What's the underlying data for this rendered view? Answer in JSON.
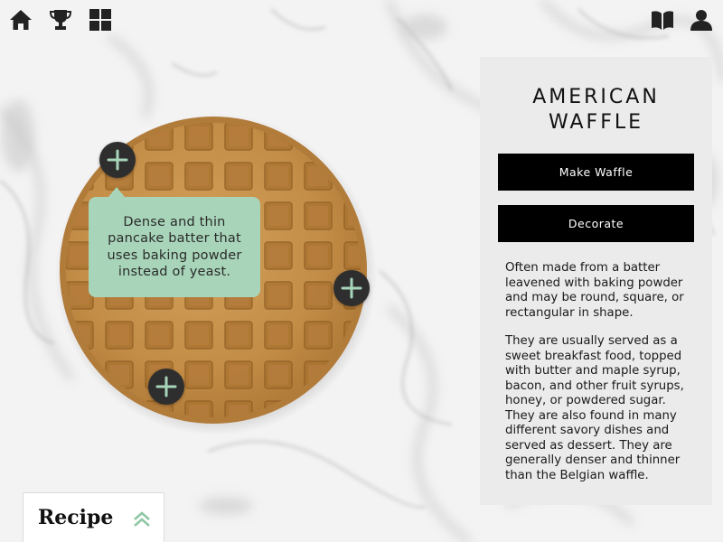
{
  "nav": {
    "left_icons": [
      "home-icon",
      "trophy-icon",
      "grid-icon"
    ],
    "right_icons": [
      "book-icon",
      "user-icon"
    ]
  },
  "tooltip": {
    "text": "Dense and thin pancake batter that uses baking powder instead of yeast."
  },
  "hotspots": [
    "plus-icon",
    "plus-icon",
    "plus-icon"
  ],
  "panel": {
    "title_line1": "AMERICAN",
    "title_line2": "WAFFLE",
    "make_button": "Make Waffle",
    "decorate_button": "Decorate",
    "paragraph1": "Often made from a batter leavened with baking powder and may be round, square, or rectangular in shape.",
    "paragraph2": "They are usually served as a sweet breakfast food, topped with butter and maple syrup, bacon, and other fruit syrups, honey, or powdered sugar. They are also found in many different savory dishes and served as dessert. They are generally denser and thinner than the Belgian waffle."
  },
  "recipe_tab": {
    "label": "Recipe"
  },
  "colors": {
    "tooltip_bg": "#a8d5b9",
    "button_bg": "#000000",
    "panel_bg": "#ebebeb",
    "hotspot_bg": "#2e2e2e",
    "chevron": "#8fc7a4",
    "waffle": "#c8964e"
  }
}
